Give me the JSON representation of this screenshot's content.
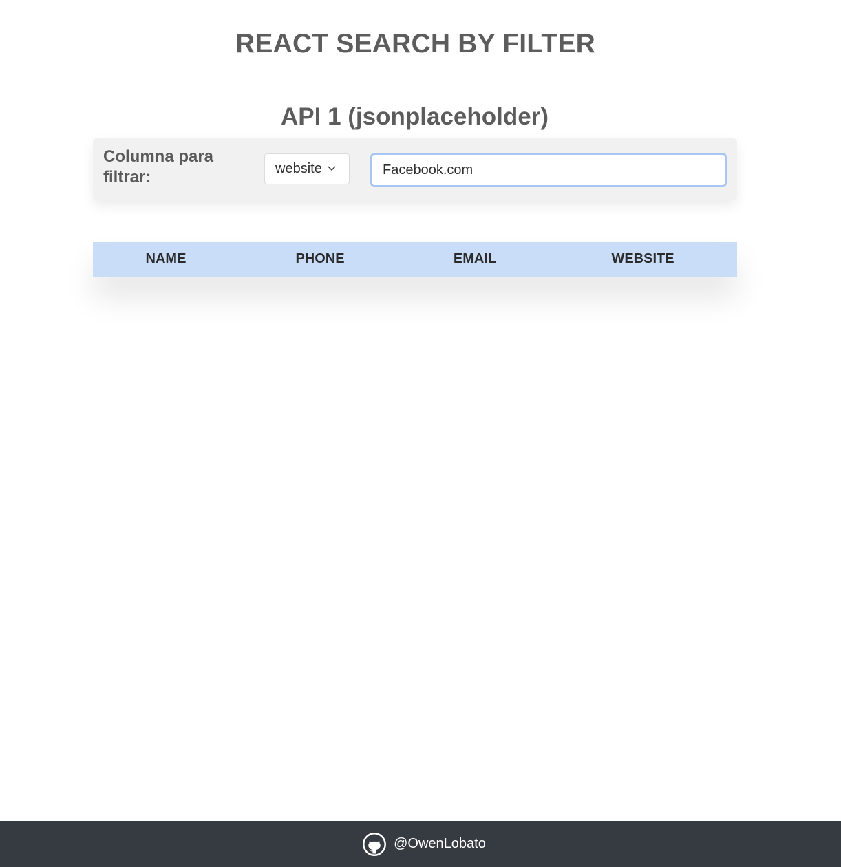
{
  "header": {
    "title": "REACT SEARCH BY FILTER"
  },
  "section": {
    "title": "API 1 (jsonplaceholder)"
  },
  "filter": {
    "label": "Columna para filtrar:",
    "select_value": "website",
    "search_value": "Facebook.com"
  },
  "table": {
    "columns": [
      "NAME",
      "PHONE",
      "EMAIL",
      "WEBSITE"
    ],
    "rows": []
  },
  "footer": {
    "handle": "@OwenLobato",
    "icon": "github-icon"
  },
  "colors": {
    "table_header_bg": "#c9ddf8",
    "footer_bg": "#363a41",
    "input_focus_border": "#a9c6f2"
  }
}
